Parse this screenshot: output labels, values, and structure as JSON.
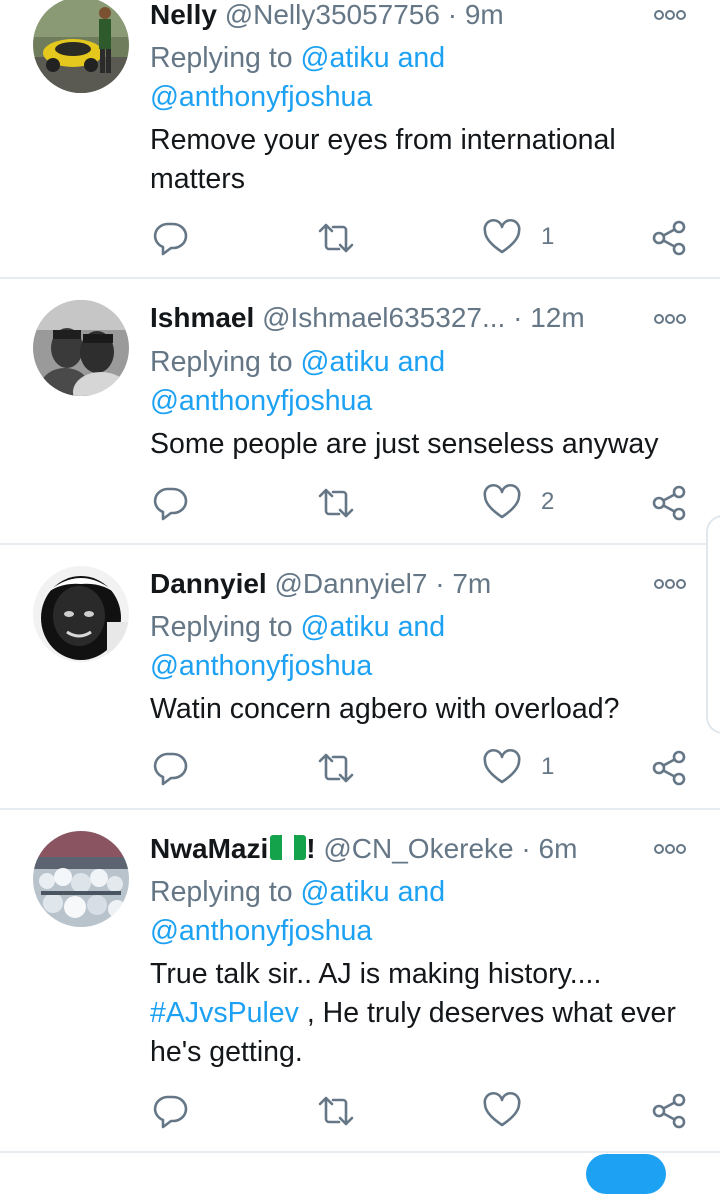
{
  "common": {
    "dot": "·",
    "replying_prefix": "Replying to",
    "reply_tail": "and"
  },
  "icons": {
    "reply": "reply-icon",
    "retweet": "retweet-icon",
    "like": "heart-icon",
    "share": "share-icon",
    "more": "more-options-icon"
  },
  "colors": {
    "accent": "#1da1f2",
    "muted": "#657786",
    "text": "#14171a",
    "divider": "#e6ecf0"
  },
  "tweets": [
    {
      "name": "Nelly",
      "handle": "@Nelly35057756",
      "time": "9m",
      "reply_user1": "@atiku",
      "reply_user2": "@anthonyfjoshua",
      "text": "Remove your eyes from international matters",
      "likes": "1"
    },
    {
      "name": "Ishmael",
      "handle": "@Ishmael635327...",
      "time": "12m",
      "reply_user1": "@atiku",
      "reply_user2": "@anthonyfjoshua",
      "text": "Some people are just senseless anyway",
      "likes": "2"
    },
    {
      "name": "Dannyiel",
      "handle": "@Dannyiel7",
      "time": "7m",
      "reply_user1": "@atiku",
      "reply_user2": "@anthonyfjoshua",
      "text": "Watin concern agbero with overload?",
      "likes": "1"
    },
    {
      "name": "NwaMazi",
      "name_suffix": "!",
      "handle": "@CN_Okereke",
      "time": "6m",
      "reply_user1": "@atiku",
      "reply_user2": "@anthonyfjoshua",
      "text_part1": "True talk sir.. AJ is making history....",
      "hashtag": "#AJvsPulev",
      "text_part2": ", He truly deserves what ever he's getting.",
      "likes": ""
    }
  ]
}
